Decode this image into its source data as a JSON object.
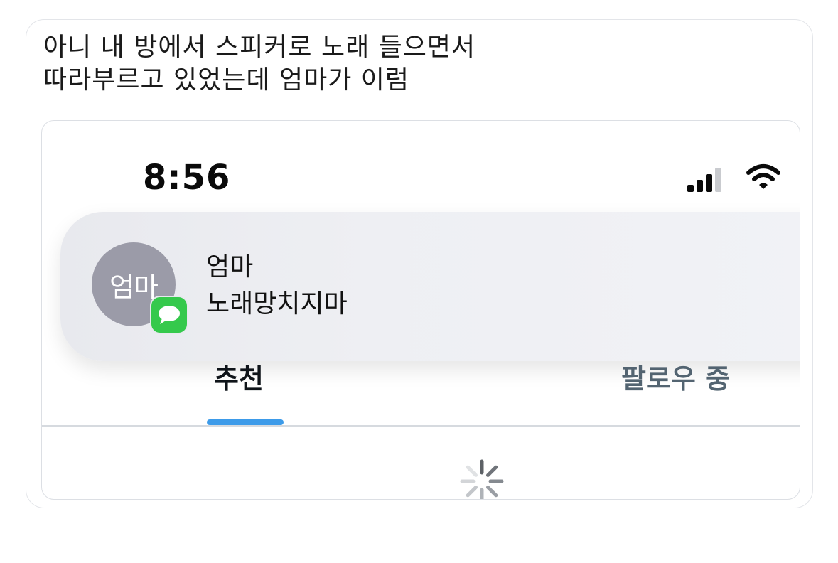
{
  "post": {
    "line1": "아니 내 방에서 스피커로 노래 들으면서",
    "line2": "따라부르고 있었는데 엄마가 이럼"
  },
  "status_bar": {
    "time": "8:56",
    "signal_icon": "cellular-signal-icon",
    "wifi_icon": "wifi-icon"
  },
  "notification": {
    "avatar_text": "엄마",
    "app_icon": "messages-app-icon",
    "sender": "엄마",
    "message": "노래망치지마"
  },
  "tabs": [
    {
      "label": "추천",
      "selected": true
    },
    {
      "label": "팔로우 중",
      "selected": false
    }
  ],
  "loading_icon": "loading-spinner-icon",
  "colors": {
    "accent": "#3d9be9",
    "avatar_bg": "#9b9ba8",
    "messages_green": "#35c94c",
    "inactive_tab": "#536471"
  }
}
